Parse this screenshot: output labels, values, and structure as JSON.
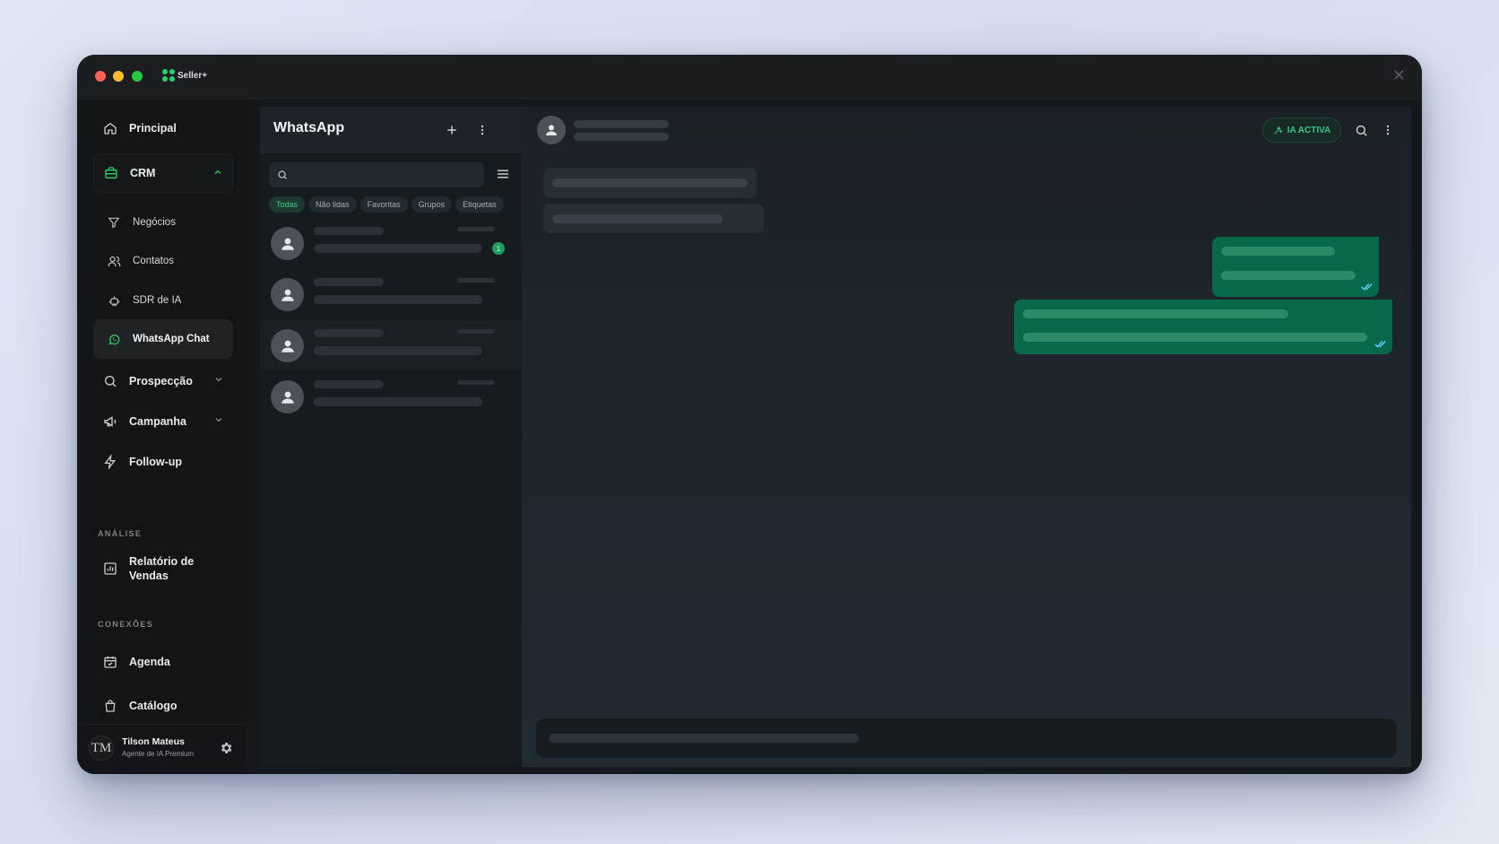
{
  "app": {
    "brand": "Seller+"
  },
  "sidebar": {
    "nav": {
      "principal": "Principal",
      "crm": "CRM",
      "prospeccao": "Prospecção",
      "campanha": "Campanha",
      "followup": "Follow-up",
      "relatorio": "Relatório de Vendas",
      "agenda": "Agenda",
      "catalogo": "Catálogo"
    },
    "crm_sub": {
      "negocios": "Negócios",
      "contatos": "Contatos",
      "sdr": "SDR de IA",
      "whatsapp": "WhatsApp Chat"
    },
    "sections": {
      "analise": "ANÁLISE",
      "conexoes": "CONEXÕES"
    },
    "active_item": "WhatsApp Chat",
    "user": {
      "initials": "TM",
      "name": "Tilson Mateus",
      "role": "Agente de IA Premium"
    }
  },
  "chatlist": {
    "title": "WhatsApp",
    "search": {
      "value": "",
      "placeholder": ""
    },
    "filters": [
      "Todas",
      "Não lidas",
      "Favoritas",
      "Grupos",
      "Etiquetas"
    ],
    "active_filter": "Todas",
    "unread_badge": "1"
  },
  "chat": {
    "ia_label": "IA ACTIVA"
  },
  "colors": {
    "accent": "#25d366",
    "outgoing_bubble": "#07694a",
    "badge": "#1d9e63"
  }
}
